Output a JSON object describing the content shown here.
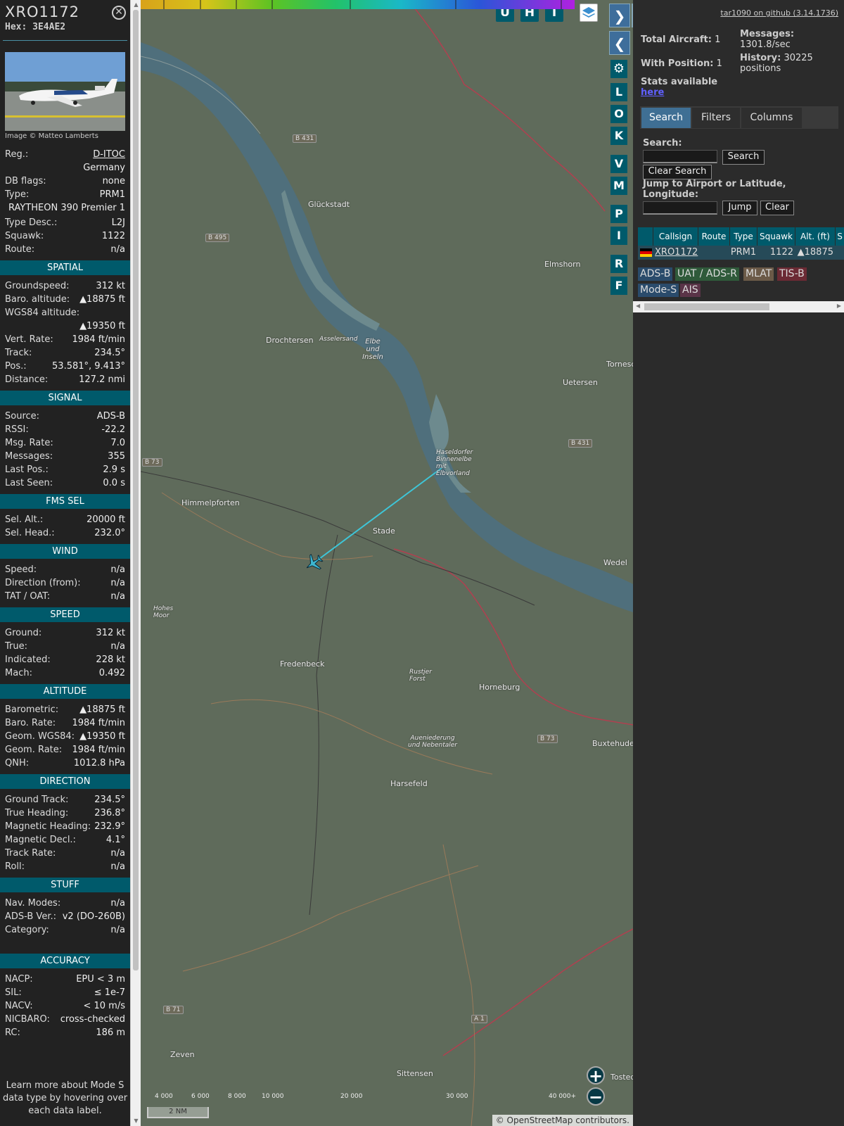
{
  "aircraft": {
    "callsign": "XRO1172",
    "hex_label": "Hex:",
    "hex": "3E4AE2",
    "photo_credit": "Image © Matteo Lamberts"
  },
  "info_rows": [
    {
      "label": "Reg.:",
      "value": "D-ITOC"
    },
    {
      "label": "",
      "value": "Germany"
    },
    {
      "label": "DB flags:",
      "value": "none"
    },
    {
      "label": "Type:",
      "value": "PRM1"
    },
    {
      "label": "",
      "value": "RAYTHEON 390 Premier 1"
    },
    {
      "label": "Type Desc.:",
      "value": "L2J"
    },
    {
      "label": "Squawk:",
      "value": "1122"
    },
    {
      "label": "Route:",
      "value": "n/a"
    }
  ],
  "sections": {
    "spatial": {
      "title": "SPATIAL",
      "rows": [
        {
          "label": "Groundspeed:",
          "value": "312 kt"
        },
        {
          "label": "Baro. altitude:",
          "value": "▲18875 ft"
        },
        {
          "label": "WGS84 altitude:",
          "value": ""
        },
        {
          "label": "",
          "value": "▲19350 ft"
        },
        {
          "label": "Vert. Rate:",
          "value": "1984 ft/min"
        },
        {
          "label": "Track:",
          "value": "234.5°"
        },
        {
          "label": "Pos.:",
          "value": "53.581°, 9.413°"
        },
        {
          "label": "Distance:",
          "value": "127.2 nmi"
        }
      ]
    },
    "signal": {
      "title": "SIGNAL",
      "rows": [
        {
          "label": "Source:",
          "value": "ADS-B"
        },
        {
          "label": "RSSI:",
          "value": "-22.2"
        },
        {
          "label": "Msg. Rate:",
          "value": "7.0"
        },
        {
          "label": "Messages:",
          "value": "355"
        },
        {
          "label": "Last Pos.:",
          "value": "2.9 s"
        },
        {
          "label": "Last Seen:",
          "value": "0.0 s"
        }
      ]
    },
    "fms": {
      "title": "FMS SEL",
      "rows": [
        {
          "label": "Sel. Alt.:",
          "value": "20000 ft"
        },
        {
          "label": "Sel. Head.:",
          "value": "232.0°"
        }
      ]
    },
    "wind": {
      "title": "WIND",
      "rows": [
        {
          "label": "Speed:",
          "value": "n/a"
        },
        {
          "label": "Direction (from):",
          "value": "n/a"
        },
        {
          "label": "TAT / OAT:",
          "value": "n/a"
        }
      ]
    },
    "speed": {
      "title": "SPEED",
      "rows": [
        {
          "label": "Ground:",
          "value": "312 kt"
        },
        {
          "label": "True:",
          "value": "n/a"
        },
        {
          "label": "Indicated:",
          "value": "228 kt"
        },
        {
          "label": "Mach:",
          "value": "0.492"
        }
      ]
    },
    "altitude": {
      "title": "ALTITUDE",
      "rows": [
        {
          "label": "Barometric:",
          "value": "▲18875 ft"
        },
        {
          "label": "Baro. Rate:",
          "value": "1984 ft/min"
        },
        {
          "label": "Geom. WGS84:",
          "value": "▲19350 ft"
        },
        {
          "label": "Geom. Rate:",
          "value": "1984 ft/min"
        },
        {
          "label": "QNH:",
          "value": "1012.8 hPa"
        }
      ]
    },
    "direction": {
      "title": "DIRECTION",
      "rows": [
        {
          "label": "Ground Track:",
          "value": "234.5°"
        },
        {
          "label": "True Heading:",
          "value": "236.8°"
        },
        {
          "label": "Magnetic Heading:",
          "value": "232.9°"
        },
        {
          "label": "Magnetic Decl.:",
          "value": "4.1°"
        },
        {
          "label": "Track Rate:",
          "value": "n/a"
        },
        {
          "label": "Roll:",
          "value": "n/a"
        }
      ]
    },
    "stuff": {
      "title": "STUFF",
      "rows": [
        {
          "label": "Nav. Modes:",
          "value": "n/a"
        },
        {
          "label": "ADS-B Ver.:",
          "value": "v2 (DO-260B)"
        },
        {
          "label": "Category:",
          "value": "n/a"
        }
      ]
    },
    "accuracy": {
      "title": "ACCURACY",
      "rows": [
        {
          "label": "NACP:",
          "value": "EPU < 3 m"
        },
        {
          "label": "SIL:",
          "value": "≤ 1e-7"
        },
        {
          "label": "NACV:",
          "value": "< 10 m/s"
        },
        {
          "label": "NICBARO:",
          "value": "cross-checked"
        },
        {
          "label": "RC:",
          "value": "186 m"
        }
      ]
    }
  },
  "footer_note": "Learn more about Mode S data type by hovering over each data label.",
  "map": {
    "top_buttons": [
      "U",
      "H",
      "T"
    ],
    "side_buttons": [
      "L",
      "O",
      "K",
      "V",
      "M",
      "P",
      "I",
      "R",
      "F"
    ],
    "labels": {
      "glueckstadt": "Glückstadt",
      "elmshorn": "Elmshorn",
      "drochtersen": "Drochtersen",
      "uetersen": "Uetersen",
      "himmelpforten": "Himmelpforten",
      "stade": "Stade",
      "wedel": "Wedel",
      "fredenbeck": "Fredenbeck",
      "horneburg": "Horneburg",
      "buxtehude": "Buxtehude",
      "harsefeld": "Harsefeld",
      "zeven": "Zeven",
      "sittensen": "Sittensen",
      "tornesch": "Tornesch",
      "tostedt": "Tosted",
      "elbe": "Elbe und Inseln",
      "asselersand": "Asselersand",
      "haseldorfer": "Haseldorfer Binnenelbe mit Elbvorland",
      "hohes_moor": "Hohes Moor",
      "rustjer_forst": "Rustjer Forst",
      "aueniederung": "Aueniederung und Nebentaler"
    },
    "roads": [
      "B 431",
      "B 495",
      "B 73",
      "B 431",
      "B 73",
      "B 71",
      "A 1"
    ],
    "altitude_scale": [
      "4 000",
      "6 000",
      "8 000",
      "10 000",
      "20 000",
      "30 000",
      "40 000+"
    ],
    "scale_label": "2 NM",
    "attribution": "© OpenStreetMap contributors."
  },
  "panel": {
    "github_link": "tar1090 on github (3.14.1736)",
    "total_aircraft_label": "Total Aircraft:",
    "total_aircraft": "1",
    "with_position_label": "With Position:",
    "with_position": "1",
    "messages_label": "Messages:",
    "messages_value": "1301.8/sec",
    "history_label": "History:",
    "history_value": "30225",
    "history_unit": "positions",
    "stats_label": "Stats available",
    "stats_link": "here",
    "tabs": [
      "Search",
      "Filters",
      "Columns"
    ],
    "search_label": "Search:",
    "search_button": "Search",
    "clear_search_button": "Clear Search",
    "jump_label": "Jump to Airport or Latitude, Longitude:",
    "jump_button": "Jump",
    "clear_button": "Clear",
    "table_headers": [
      "Callsign",
      "Route",
      "Type",
      "Squawk",
      "Alt. (ft)",
      "S"
    ],
    "table_rows": [
      {
        "callsign": "XRO1172",
        "route": "",
        "type": "PRM1",
        "squawk": "1122",
        "alt": "▲18875"
      }
    ],
    "source_chips": [
      {
        "label": "ADS-B",
        "color": "#2a4b6b"
      },
      {
        "label": "UAT / ADS-R",
        "color": "#2f5a3a"
      },
      {
        "label": "MLAT",
        "color": "#6b5a48"
      },
      {
        "label": "TIS-B",
        "color": "#6b2a34"
      },
      {
        "label": "Mode-S",
        "color": "#2a4b6b"
      },
      {
        "label": "AIS",
        "color": "#5a3448"
      }
    ]
  }
}
